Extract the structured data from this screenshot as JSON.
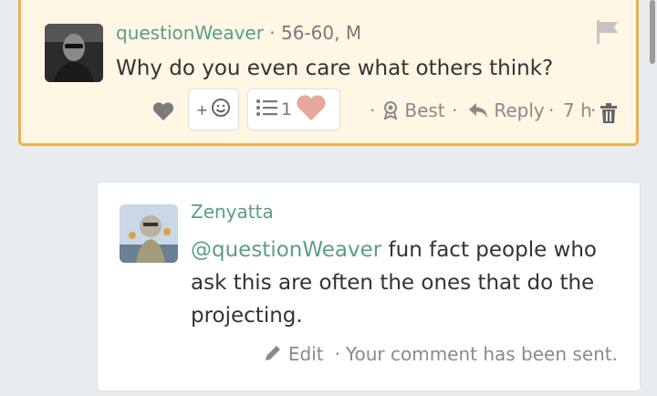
{
  "comment": {
    "author": "questionWeaver",
    "meta": "· 56-60, M",
    "text": "Why do you even care what others think?",
    "actions": {
      "add_reaction": "+",
      "reaction_count": "1",
      "sep1": "·",
      "best": "Best",
      "sep2": "·",
      "reply": "Reply",
      "sep3": "·",
      "time": "7 h",
      "sep4": "·"
    }
  },
  "reply": {
    "author": "Zenyatta",
    "mention": "@questionWeaver",
    "text": " fun fact people who ask this are often the ones that do the projecting.",
    "edit": "Edit",
    "sep": "·",
    "status": "Your comment has been sent."
  },
  "colors": {
    "highlight_bg": "#fff6e4",
    "highlight_border": "#f0b24a",
    "accent": "#5a9e89"
  }
}
